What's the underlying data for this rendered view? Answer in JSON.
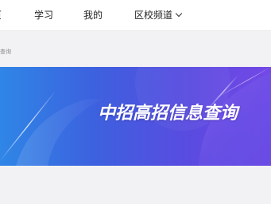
{
  "topnav": {
    "items": [
      {
        "label": "页"
      },
      {
        "label": "学习"
      },
      {
        "label": "我的"
      },
      {
        "label": "区校频道"
      }
    ]
  },
  "breadcrumb": {
    "text": "查询"
  },
  "banner": {
    "title": "中招高招信息查询",
    "colors": {
      "gradient_start": "#2f86e6",
      "gradient_mid": "#3d61df",
      "gradient_end": "#7448e6"
    }
  }
}
